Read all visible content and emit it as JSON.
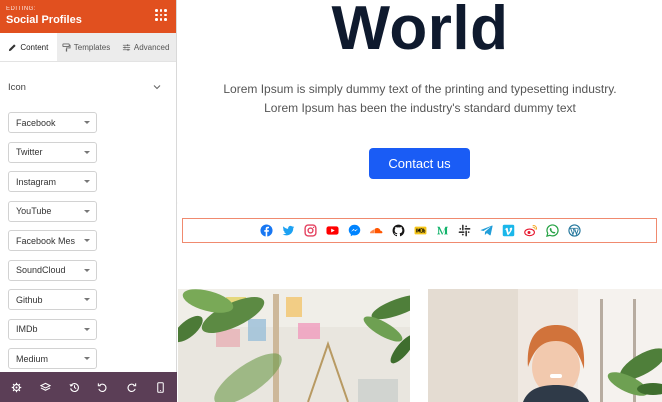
{
  "sidebar": {
    "editing_label": "EDITING:",
    "title": "Social Profiles",
    "tabs": [
      {
        "label": "Content",
        "icon": "pencil-icon"
      },
      {
        "label": "Templates",
        "icon": "paint-roller-icon"
      },
      {
        "label": "Advanced",
        "icon": "sliders-icon"
      }
    ],
    "section_title": "Icon",
    "items": [
      {
        "label": "Facebook"
      },
      {
        "label": "Twitter"
      },
      {
        "label": "Instagram"
      },
      {
        "label": "YouTube"
      },
      {
        "label": "Facebook Mes"
      },
      {
        "label": "SoundCloud"
      },
      {
        "label": "Github"
      },
      {
        "label": "IMDb"
      },
      {
        "label": "Medium"
      }
    ],
    "footer_icons": [
      "gear-icon",
      "layers-icon",
      "history-icon",
      "undo-icon",
      "redo-icon",
      "mobile-icon"
    ],
    "header_color": "#e1501f",
    "footer_color": "#5b3e56"
  },
  "main": {
    "hero_title": "World",
    "hero_text_line1": "Lorem Ipsum is simply dummy text of the printing and typesetting industry.",
    "hero_text_line2": "Lorem Ipsum has been the industry's standard dummy text",
    "cta_label": "Contact us",
    "cta_color": "#1a5cf5",
    "social_icons": [
      "facebook-icon",
      "twitter-icon",
      "instagram-icon",
      "youtube-icon",
      "messenger-icon",
      "soundcloud-icon",
      "github-icon",
      "imdb-icon",
      "medium-icon",
      "slack-icon",
      "telegram-icon",
      "vimeo-icon",
      "weibo-icon",
      "whatsapp-icon",
      "wordpress-icon"
    ],
    "social_bar_border_color": "#f08a6f"
  }
}
